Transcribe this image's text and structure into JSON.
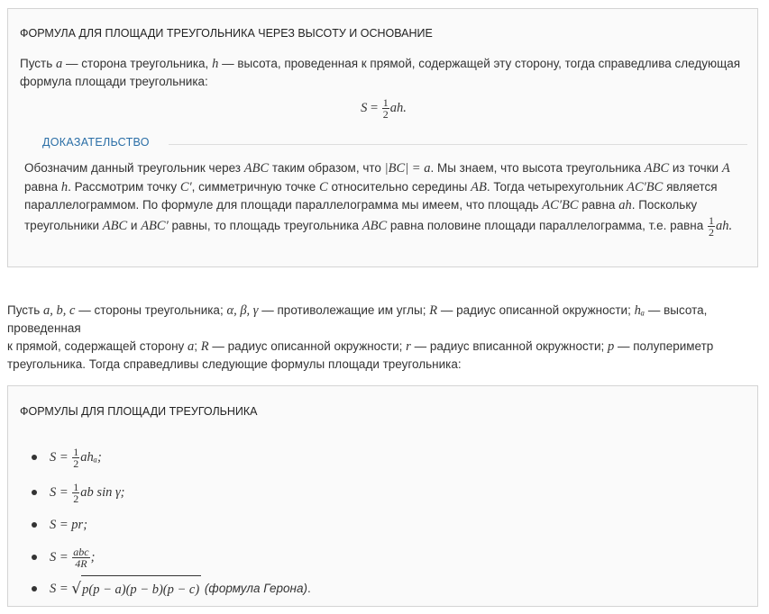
{
  "box1": {
    "title": "ФОРМУЛА ДЛЯ ПЛОЩАДИ ТРЕУГОЛЬНИКА ЧЕРЕЗ ВЫСОТУ И ОСНОВАНИЕ",
    "intro": {
      "t1": "Пусть ",
      "v_a": "a",
      "t2": " — сторона треугольника, ",
      "v_h": "h",
      "t3": " — высота, проведенная к прямой, содержащей эту сторону, тогда справедлива следующая",
      "t4": "формула площади треугольника:"
    },
    "main_formula": {
      "lhs": "S",
      "eq": " = ",
      "num": "1",
      "den": "2",
      "rhs": "ah."
    },
    "proof_heading": "ДОКАЗАТЕЛЬСТВО",
    "proof": {
      "p1": "Обозначим данный треугольник через ",
      "m1": "ABC",
      "p2": " таким образом, что ",
      "m2": "|BC| = a",
      "p3": ". Мы знаем, что высота треугольника ",
      "m3": "ABC",
      "p4": " из точки ",
      "m4": "A",
      "p5": "равна ",
      "m5": "h",
      "p6": ". Рассмотрим точку ",
      "m6": "C′",
      "p7": ", симметричную точке ",
      "m7": "C",
      "p8": " относительно середины ",
      "m8": "AB",
      "p9": ". Тогда четырехугольник ",
      "m9": "AC′BC",
      "p10": " является",
      "p11": "параллелограммом. По формуле для площади параллелограмма мы имеем, что площадь ",
      "m10": "AC′BC",
      "p12": " равна ",
      "m11": "ah",
      "p13": ". Поскольку",
      "p14": "треугольники ",
      "m12": "ABC",
      "p15": " и ",
      "m13": "ABC′",
      "p16": " равны, то площадь треугольника ",
      "m14": "ABC",
      "p17": " равна половине площади параллелограмма, т.е. равна ",
      "fnum": "1",
      "fden": "2",
      "m15": "ah."
    }
  },
  "middle": {
    "s1": "Пусть ",
    "v1": "a, b, c",
    "s2": " — стороны треугольника; ",
    "v2": "α, β, γ",
    "s3": " — противолежащие им углы; ",
    "v3": "R",
    "s4": " — радиус описанной окружности; ",
    "v4": "hₐ",
    "s5": " — высота, проведенная",
    "s6": "к прямой, содержащей сторону ",
    "v5": "a",
    "s7": "; ",
    "v6": "R",
    "s8": " — радиус описанной окружности; ",
    "v7": "r",
    "s9": " — радиус вписанной окружности; ",
    "v8": "p",
    "s10": " — полупериметр",
    "s11": "треугольника. Тогда справедливы следующие формулы площади треугольника:"
  },
  "box2": {
    "title": "ФОРМУЛЫ ДЛЯ ПЛОЩАДИ ТРЕУГОЛЬНИКА",
    "formulas": [
      {
        "lhs": "S = ",
        "num": "1",
        "den": "2",
        "rhs": "ahₐ;"
      },
      {
        "lhs": "S = ",
        "num": "1",
        "den": "2",
        "rhs": "ab sin γ;"
      },
      {
        "lhs": "S = ",
        "rhs": "pr;"
      },
      {
        "lhs": "S = ",
        "num": "abc",
        "den": "4R",
        "rhs": ";"
      },
      {
        "lhs": "S = ",
        "sqrt": "p(p − a)(p − b)(p − c)",
        "note": " (формула Герона)",
        "end": "."
      }
    ]
  }
}
